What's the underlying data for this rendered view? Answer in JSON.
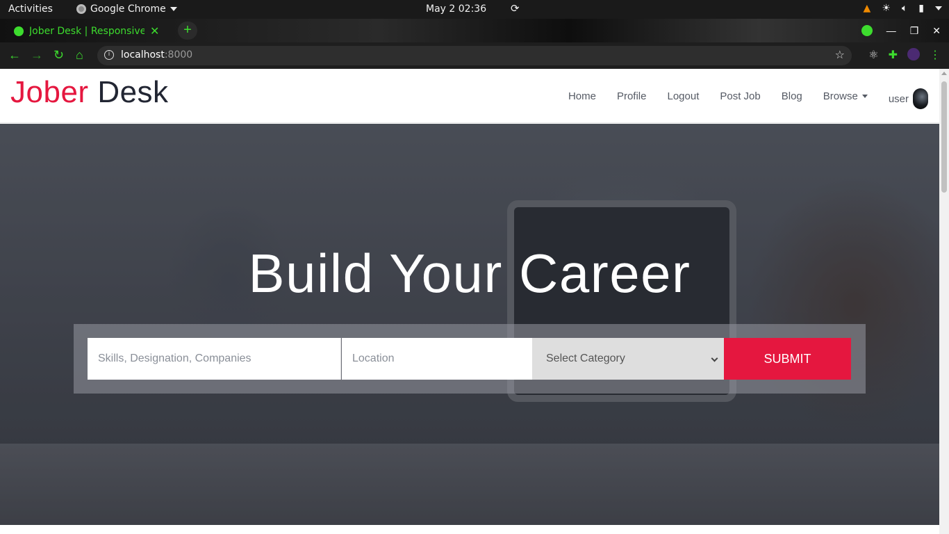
{
  "os": {
    "activities": "Activities",
    "app_name": "Google Chrome",
    "clock": "May 2  02:36"
  },
  "browser": {
    "tab_title": "Jober Desk | Responsive J",
    "tab_close": "✕",
    "new_tab": "+",
    "url_host": "localhost",
    "url_port": ":8000",
    "accent_color": "#3ddc2e"
  },
  "site": {
    "logo_part1": "Jober",
    "logo_part2": "Desk",
    "brand_color": "#e5173f",
    "nav": {
      "home": "Home",
      "profile": "Profile",
      "logout": "Logout",
      "post_job": "Post Job",
      "blog": "Blog",
      "browse": "Browse",
      "user": "user"
    },
    "hero": {
      "title": "Build Your Career",
      "search": {
        "keywords_placeholder": "Skills, Designation, Companies",
        "location_placeholder": "Location",
        "category_selected": "Select Category",
        "submit_label": "SUBMIT"
      }
    }
  }
}
